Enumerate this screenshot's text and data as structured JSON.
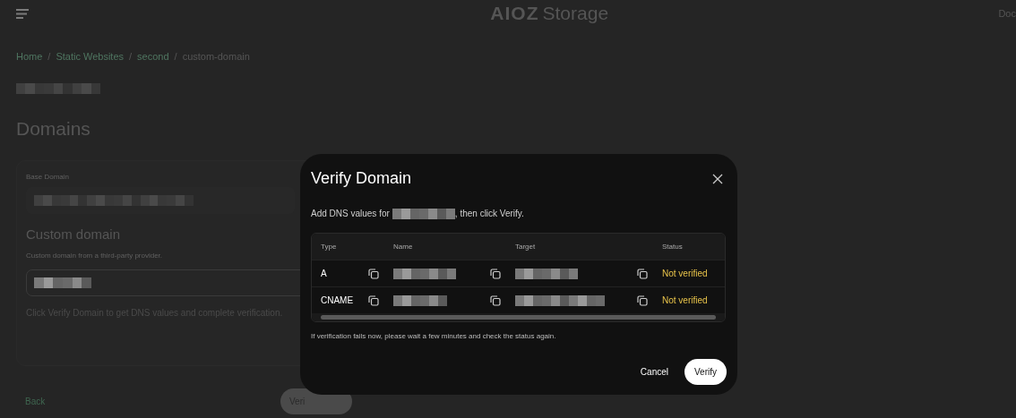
{
  "header": {
    "logo_mark": "AIOZ",
    "logo_text": "Storage",
    "nav_link": "Doc"
  },
  "breadcrumb": [
    {
      "label": "Home",
      "link": true
    },
    {
      "separator": "/"
    },
    {
      "label": "Static Websites",
      "link": true
    },
    {
      "separator": "/"
    },
    {
      "label": "second",
      "link": true
    },
    {
      "separator": "/"
    },
    {
      "label": "custom-domain",
      "link": false
    }
  ],
  "section_title": "Domains",
  "base_domain": {
    "label": "Base Domain"
  },
  "custom_domain": {
    "title": "Custom domain",
    "subtitle": "Custom domain from a third-party provider.",
    "help": "Click Verify Domain to get DNS values and complete verification."
  },
  "footer": {
    "back": "Back",
    "verify": "Veri"
  },
  "dialog": {
    "title": "Verify Domain",
    "intro_before": "Add DNS values for",
    "intro_after": ", then click Verify.",
    "columns": [
      "Type",
      "Name",
      "Target",
      "Status"
    ],
    "rows": [
      {
        "type": "A",
        "status": "Not verified"
      },
      {
        "type": "CNAME",
        "status": "Not verified"
      }
    ],
    "note": "If verification fails now, please wait a few minutes and check the status again.",
    "buttons": [
      {
        "label": "Cancel",
        "kind": "text"
      },
      {
        "label": "Verify",
        "kind": "primary"
      }
    ]
  }
}
